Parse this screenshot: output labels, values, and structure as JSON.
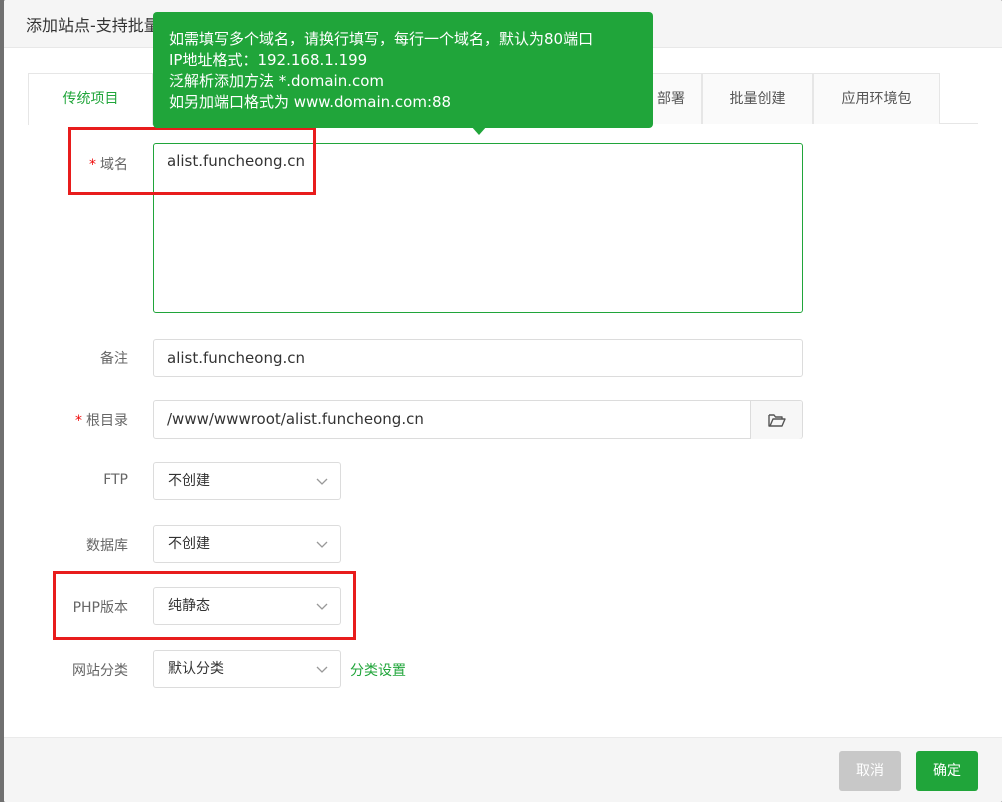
{
  "dialog": {
    "title": "添加站点-支持批量建站"
  },
  "tabs": [
    {
      "label": "传统项目"
    },
    {
      "label": "部署"
    },
    {
      "label": "批量创建"
    },
    {
      "label": "应用环境包"
    }
  ],
  "tooltip": {
    "lines": [
      "如需填写多个域名，请换行填写，每行一个域名，默认为80端口",
      "IP地址格式：192.168.1.199",
      "泛解析添加方法 *.domain.com",
      "如另加端口格式为 www.domain.com:88"
    ]
  },
  "form": {
    "domain": {
      "label": "域名",
      "required_mark": "*",
      "value": "alist.funcheong.cn"
    },
    "remark": {
      "label": "备注",
      "value": "alist.funcheong.cn"
    },
    "root": {
      "label": "根目录",
      "required_mark": "*",
      "value": "/www/wwwroot/alist.funcheong.cn"
    },
    "ftp": {
      "label": "FTP",
      "selected": "不创建"
    },
    "database": {
      "label": "数据库",
      "selected": "不创建"
    },
    "php": {
      "label": "PHP版本",
      "selected": "纯静态"
    },
    "category": {
      "label": "网站分类",
      "selected": "默认分类",
      "settings_link": "分类设置"
    }
  },
  "footer": {
    "cancel_label": "取消",
    "ok_label": "确定"
  },
  "colors": {
    "accent": "#20a53a",
    "annotation": "#e81c1c",
    "required": "#ef0808"
  },
  "icons": [
    "folder-icon",
    "chevron-down-icon",
    "close-icon"
  ]
}
